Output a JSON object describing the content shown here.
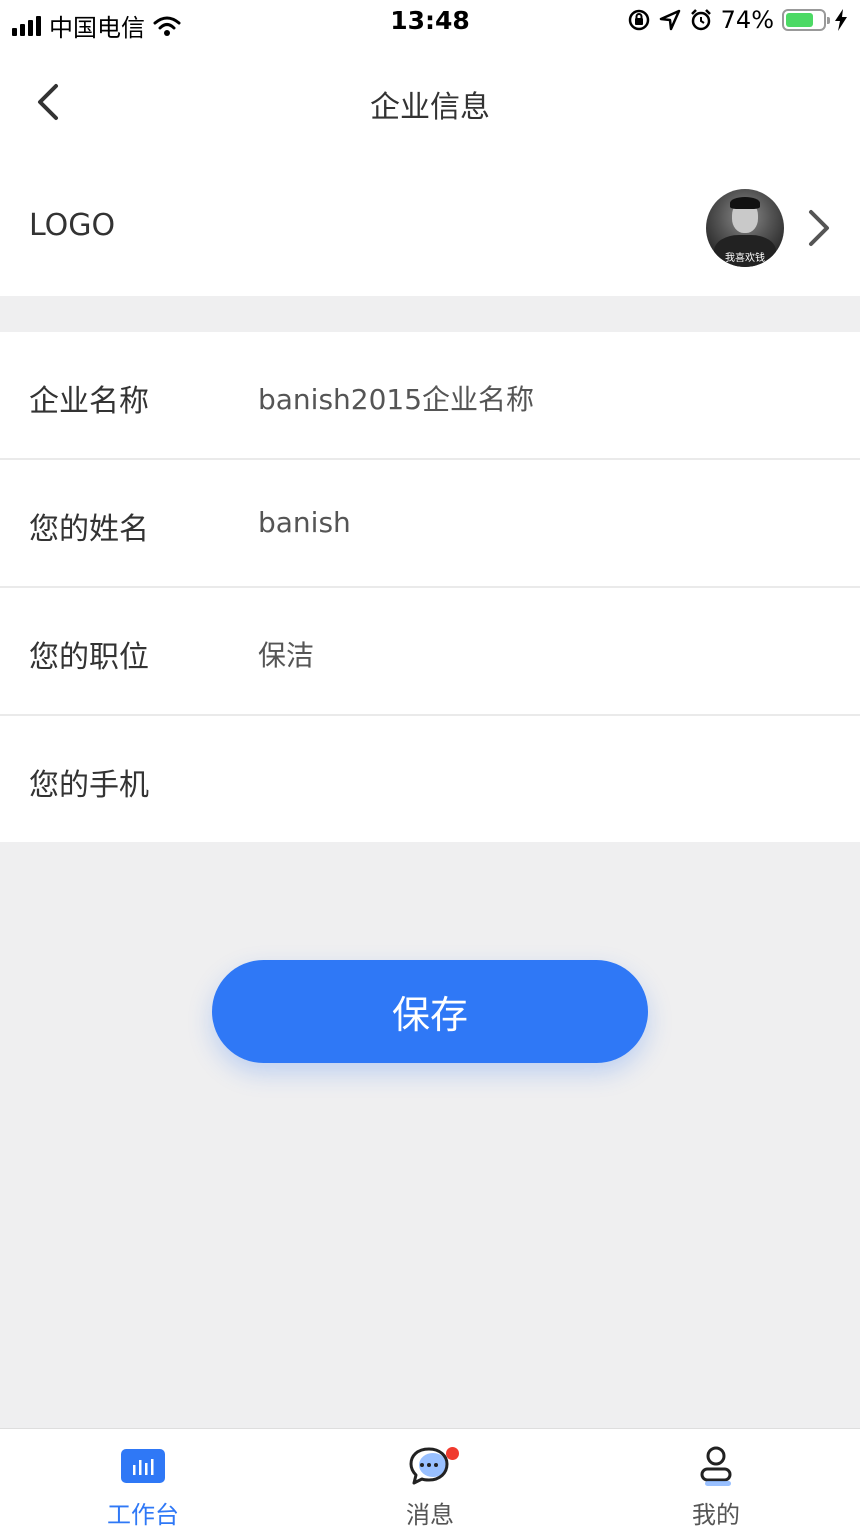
{
  "status_bar": {
    "carrier": "中国电信",
    "time": "13:48",
    "battery": "74%",
    "battery_level": 0.74
  },
  "nav": {
    "title": "企业信息"
  },
  "logo_row": {
    "label": "LOGO",
    "avatar_caption": "我喜欢钱"
  },
  "form": {
    "rows": [
      {
        "label": "企业名称",
        "value": "banish2015企业名称"
      },
      {
        "label": "您的姓名",
        "value": "banish"
      },
      {
        "label": "您的职位",
        "value": "保洁"
      },
      {
        "label": "您的手机",
        "value": ""
      }
    ]
  },
  "actions": {
    "save_label": "保存"
  },
  "tabs": [
    {
      "label": "工作台",
      "icon": "workbench-chart-icon",
      "active": true
    },
    {
      "label": "消息",
      "icon": "message-bubble-icon",
      "active": false,
      "badge": true
    },
    {
      "label": "我的",
      "icon": "user-profile-icon",
      "active": false
    }
  ],
  "colors": {
    "accent": "#2f78f6",
    "badge": "#f03a2e",
    "background": "#efeff0"
  }
}
